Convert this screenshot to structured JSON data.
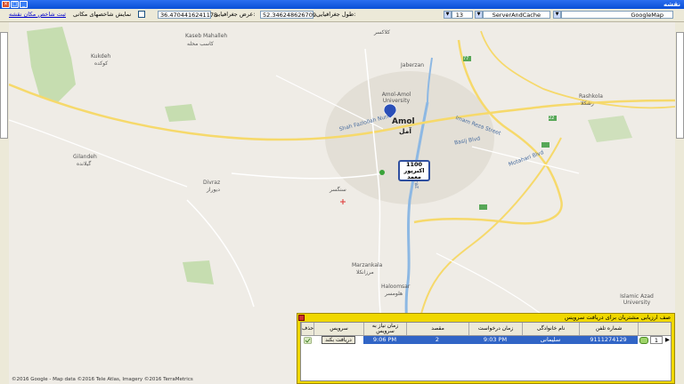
{
  "window": {
    "title": "نقشه"
  },
  "toolbar": {
    "map_source": "GoogleMap",
    "cache_mode": "ServerAndCache",
    "zoom": "13",
    "longitude_label": "طول جغرافیایی:",
    "longitude_value": "52.346248626709",
    "latitude_label": "عرض جغرافیایی:",
    "latitude_value": "36.4704416241178",
    "show_markers_label": "نمایش شاخصهای مکانی",
    "register_link": "ثبت شاخص مکان نقشه"
  },
  "map": {
    "labels": {
      "kalaksar": "کلاکسر",
      "hajiabad": "Jaberzan",
      "amol_uni": "Amol-Amol University",
      "amol": "Amol",
      "amol_fa": "آمل",
      "rashkola": "Rashkola",
      "rashkola_fa": "رشکلا",
      "kaseb": "Kaseb Mahalleh",
      "kaseb_fa": "کاسب محله",
      "kukdeh": "Kukdeh",
      "kukdeh_fa": "کوکده",
      "gilandeh": "Gilandeh",
      "gilandeh_fa": "گیلانده",
      "divraz": "Divraz",
      "divraz_fa": "دیوراز",
      "marzankala": "Marzankala",
      "marzankala_fa": "مرزانکلا",
      "haloomsar": "Haloomsar",
      "haloomsar_fa": "هلومسر",
      "islamic_azad": "Islamic Azad University",
      "shah_fazlollah": "Shah Fazlollah Nuri",
      "imam_reza": "Imam Reza Street",
      "basij": "Basij Blvd",
      "motahari": "Motahari Blvd",
      "haraz": "Haraz",
      "sangesar": "سنگسر",
      "road_77": "77",
      "road_22": "22"
    },
    "attribution": "©2016 Google - Map data ©2016 Tele Atlas, Imagery ©2016 TerraMetrics"
  },
  "marker": {
    "id": "1100",
    "name": "اکبرپور",
    "sub": "معمد"
  },
  "panel": {
    "title": "صف ارزیابی مشتریان برای دریافت سرویس",
    "columns": [
      "شماره تلفن",
      "نام خانوادگی",
      "زمان درخواست",
      "مقصد",
      "زمان نیاز به سرویس",
      "سرویس",
      "حذف"
    ],
    "row": {
      "index": "1",
      "phone": "9111274129",
      "family": "سلیمانی",
      "request_time": "9:03 PM",
      "destination": "2",
      "need_time": "9:06 PM",
      "service_btn": "دریافت بکند"
    }
  },
  "colors": {
    "accent": "#3165c6",
    "panel_bg": "#f0d800",
    "road_major": "#f6d96b",
    "river": "#8db8e3"
  }
}
